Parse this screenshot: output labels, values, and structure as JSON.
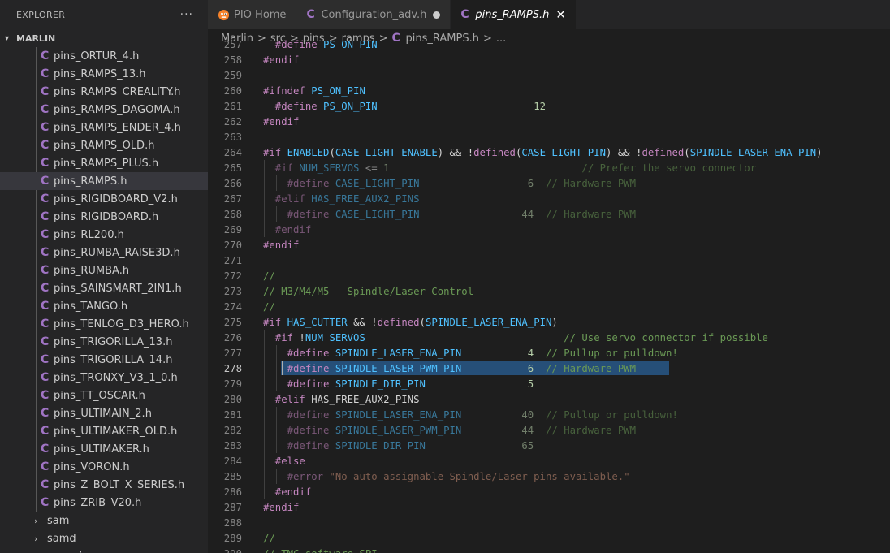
{
  "sidebar": {
    "title": "EXPLORER",
    "more_label": "···",
    "root_folder": "MARLIN",
    "files": [
      {
        "name": "pins_ORTUR_4.h",
        "active": false
      },
      {
        "name": "pins_RAMPS_13.h",
        "active": false
      },
      {
        "name": "pins_RAMPS_CREALITY.h",
        "active": false
      },
      {
        "name": "pins_RAMPS_DAGOMA.h",
        "active": false
      },
      {
        "name": "pins_RAMPS_ENDER_4.h",
        "active": false
      },
      {
        "name": "pins_RAMPS_OLD.h",
        "active": false
      },
      {
        "name": "pins_RAMPS_PLUS.h",
        "active": false
      },
      {
        "name": "pins_RAMPS.h",
        "active": true
      },
      {
        "name": "pins_RIGIDBOARD_V2.h",
        "active": false
      },
      {
        "name": "pins_RIGIDBOARD.h",
        "active": false
      },
      {
        "name": "pins_RL200.h",
        "active": false
      },
      {
        "name": "pins_RUMBA_RAISE3D.h",
        "active": false
      },
      {
        "name": "pins_RUMBA.h",
        "active": false
      },
      {
        "name": "pins_SAINSMART_2IN1.h",
        "active": false
      },
      {
        "name": "pins_TANGO.h",
        "active": false
      },
      {
        "name": "pins_TENLOG_D3_HERO.h",
        "active": false
      },
      {
        "name": "pins_TRIGORILLA_13.h",
        "active": false
      },
      {
        "name": "pins_TRIGORILLA_14.h",
        "active": false
      },
      {
        "name": "pins_TRONXY_V3_1_0.h",
        "active": false
      },
      {
        "name": "pins_TT_OSCAR.h",
        "active": false
      },
      {
        "name": "pins_ULTIMAIN_2.h",
        "active": false
      },
      {
        "name": "pins_ULTIMAKER_OLD.h",
        "active": false
      },
      {
        "name": "pins_ULTIMAKER.h",
        "active": false
      },
      {
        "name": "pins_VORON.h",
        "active": false
      },
      {
        "name": "pins_Z_BOLT_X_SERIES.h",
        "active": false
      },
      {
        "name": "pins_ZRIB_V20.h",
        "active": false
      }
    ],
    "folders": [
      {
        "name": "sam"
      },
      {
        "name": "samd"
      },
      {
        "name": "sanguino"
      }
    ]
  },
  "tabs": [
    {
      "label": "PIO Home",
      "icon": "platformio-icon"
    },
    {
      "label": "Configuration_adv.h",
      "icon": "c-file-icon",
      "dirty": true
    },
    {
      "label": "pins_RAMPS.h",
      "icon": "c-file-icon",
      "active": true,
      "close": "✕"
    }
  ],
  "breadcrumb": {
    "items": [
      "Marlin",
      "src",
      "pins",
      "ramps",
      "pins_RAMPS.h",
      "..."
    ],
    "separator": ">"
  },
  "editor": {
    "current_line": 278,
    "lines": [
      {
        "n": 257,
        "segs": [
          [
            "pp",
            "  #define "
          ],
          [
            "mac",
            "PS_ON_PIN"
          ],
          [
            "txt",
            "                        "
          ],
          [
            "num",
            " "
          ]
        ]
      },
      {
        "n": 258,
        "segs": [
          [
            "pp",
            "#endif"
          ]
        ]
      },
      {
        "n": 259,
        "segs": []
      },
      {
        "n": 260,
        "segs": [
          [
            "pp",
            "#ifndef "
          ],
          [
            "mac",
            "PS_ON_PIN"
          ]
        ]
      },
      {
        "n": 261,
        "segs": [
          [
            "pp",
            "  #define "
          ],
          [
            "mac",
            "PS_ON_PIN"
          ],
          [
            "txt",
            "                          "
          ],
          [
            "num",
            "12"
          ]
        ]
      },
      {
        "n": 262,
        "segs": [
          [
            "pp",
            "#endif"
          ]
        ]
      },
      {
        "n": 263,
        "segs": []
      },
      {
        "n": 264,
        "segs": [
          [
            "pp",
            "#if "
          ],
          [
            "mac",
            "ENABLED"
          ],
          [
            "op",
            "("
          ],
          [
            "mac",
            "CASE_LIGHT_ENABLE"
          ],
          [
            "op",
            ") && !"
          ],
          [
            "pp",
            "defined"
          ],
          [
            "op",
            "("
          ],
          [
            "mac",
            "CASE_LIGHT_PIN"
          ],
          [
            "op",
            ") && !"
          ],
          [
            "pp",
            "defined"
          ],
          [
            "op",
            "("
          ],
          [
            "mac",
            "SPINDLE_LASER_ENA_PIN"
          ],
          [
            "op",
            ")"
          ]
        ]
      },
      {
        "n": 265,
        "segs": [
          [
            "pp dim",
            "  #if "
          ],
          [
            "mac dim",
            "NUM_SERVOS"
          ],
          [
            "op dim",
            " <= "
          ],
          [
            "num dim",
            "1"
          ],
          [
            "txt",
            "                                "
          ],
          [
            "cm dim",
            "// Prefer the servo connector"
          ]
        ]
      },
      {
        "n": 266,
        "segs": [
          [
            "pp dim",
            "    #define "
          ],
          [
            "mac dim",
            "CASE_LIGHT_PIN"
          ],
          [
            "txt",
            "                  "
          ],
          [
            "num dim",
            "6"
          ],
          [
            "txt",
            "  "
          ],
          [
            "cm dim",
            "// Hardware PWM"
          ]
        ]
      },
      {
        "n": 267,
        "segs": [
          [
            "pp dim",
            "  #elif "
          ],
          [
            "mac dim",
            "HAS_FREE_AUX2_PINS"
          ]
        ]
      },
      {
        "n": 268,
        "segs": [
          [
            "pp dim",
            "    #define "
          ],
          [
            "mac dim",
            "CASE_LIGHT_PIN"
          ],
          [
            "txt",
            "                 "
          ],
          [
            "num dim",
            "44"
          ],
          [
            "txt",
            "  "
          ],
          [
            "cm dim",
            "// Hardware PWM"
          ]
        ]
      },
      {
        "n": 269,
        "segs": [
          [
            "pp dim",
            "  #endif"
          ]
        ]
      },
      {
        "n": 270,
        "segs": [
          [
            "pp",
            "#endif"
          ]
        ]
      },
      {
        "n": 271,
        "segs": []
      },
      {
        "n": 272,
        "segs": [
          [
            "cm",
            "//"
          ]
        ]
      },
      {
        "n": 273,
        "segs": [
          [
            "cm",
            "// M3/M4/M5 - Spindle/Laser Control"
          ]
        ]
      },
      {
        "n": 274,
        "segs": [
          [
            "cm",
            "//"
          ]
        ]
      },
      {
        "n": 275,
        "segs": [
          [
            "pp",
            "#if "
          ],
          [
            "mac",
            "HAS_CUTTER"
          ],
          [
            "op",
            " && !"
          ],
          [
            "pp",
            "defined"
          ],
          [
            "op",
            "("
          ],
          [
            "mac",
            "SPINDLE_LASER_ENA_PIN"
          ],
          [
            "op",
            ")"
          ]
        ]
      },
      {
        "n": 276,
        "segs": [
          [
            "pp",
            "  #if "
          ],
          [
            "op",
            "!"
          ],
          [
            "mac",
            "NUM_SERVOS"
          ],
          [
            "txt",
            "                                 "
          ],
          [
            "cm",
            "// Use servo connector if possible"
          ]
        ]
      },
      {
        "n": 277,
        "segs": [
          [
            "pp",
            "    #define "
          ],
          [
            "mac",
            "SPINDLE_LASER_ENA_PIN"
          ],
          [
            "txt",
            "           "
          ],
          [
            "num",
            "4"
          ],
          [
            "txt",
            "  "
          ],
          [
            "cm",
            "// Pullup or pulldown!"
          ]
        ]
      },
      {
        "n": 278,
        "segs": [
          [
            "pp",
            "    #define "
          ],
          [
            "mac",
            "SPINDLE_LASER_PWM_PIN"
          ],
          [
            "txt",
            "           "
          ],
          [
            "num",
            "6"
          ],
          [
            "txt",
            "  "
          ],
          [
            "cm",
            "// Hardware PWM"
          ]
        ]
      },
      {
        "n": 279,
        "segs": [
          [
            "pp",
            "    #define "
          ],
          [
            "mac",
            "SPINDLE_DIR_PIN"
          ],
          [
            "txt",
            "                 "
          ],
          [
            "num",
            "5"
          ]
        ]
      },
      {
        "n": 280,
        "segs": [
          [
            "pp",
            "  #elif "
          ],
          [
            "txt",
            "HAS_FREE_AUX2_PINS"
          ]
        ]
      },
      {
        "n": 281,
        "segs": [
          [
            "pp dim",
            "    #define "
          ],
          [
            "mac dim",
            "SPINDLE_LASER_ENA_PIN"
          ],
          [
            "txt",
            "          "
          ],
          [
            "num dim",
            "40"
          ],
          [
            "txt",
            "  "
          ],
          [
            "cm dim",
            "// Pullup or pulldown!"
          ]
        ]
      },
      {
        "n": 282,
        "segs": [
          [
            "pp dim",
            "    #define "
          ],
          [
            "mac dim",
            "SPINDLE_LASER_PWM_PIN"
          ],
          [
            "txt",
            "          "
          ],
          [
            "num dim",
            "44"
          ],
          [
            "txt",
            "  "
          ],
          [
            "cm dim",
            "// Hardware PWM"
          ]
        ]
      },
      {
        "n": 283,
        "segs": [
          [
            "pp dim",
            "    #define "
          ],
          [
            "mac dim",
            "SPINDLE_DIR_PIN"
          ],
          [
            "txt",
            "                "
          ],
          [
            "num dim",
            "65"
          ]
        ]
      },
      {
        "n": 284,
        "segs": [
          [
            "pp",
            "  #else"
          ]
        ]
      },
      {
        "n": 285,
        "segs": [
          [
            "pp dim",
            "    #error "
          ],
          [
            "str dim",
            "\"No auto-assignable Spindle/Laser pins available.\""
          ]
        ]
      },
      {
        "n": 286,
        "segs": [
          [
            "pp",
            "  #endif"
          ]
        ]
      },
      {
        "n": 287,
        "segs": [
          [
            "pp",
            "#endif"
          ]
        ]
      },
      {
        "n": 288,
        "segs": []
      },
      {
        "n": 289,
        "segs": [
          [
            "cm",
            "//"
          ]
        ]
      },
      {
        "n": 290,
        "segs": [
          [
            "cm",
            "// TMC software SPI"
          ]
        ]
      }
    ]
  }
}
